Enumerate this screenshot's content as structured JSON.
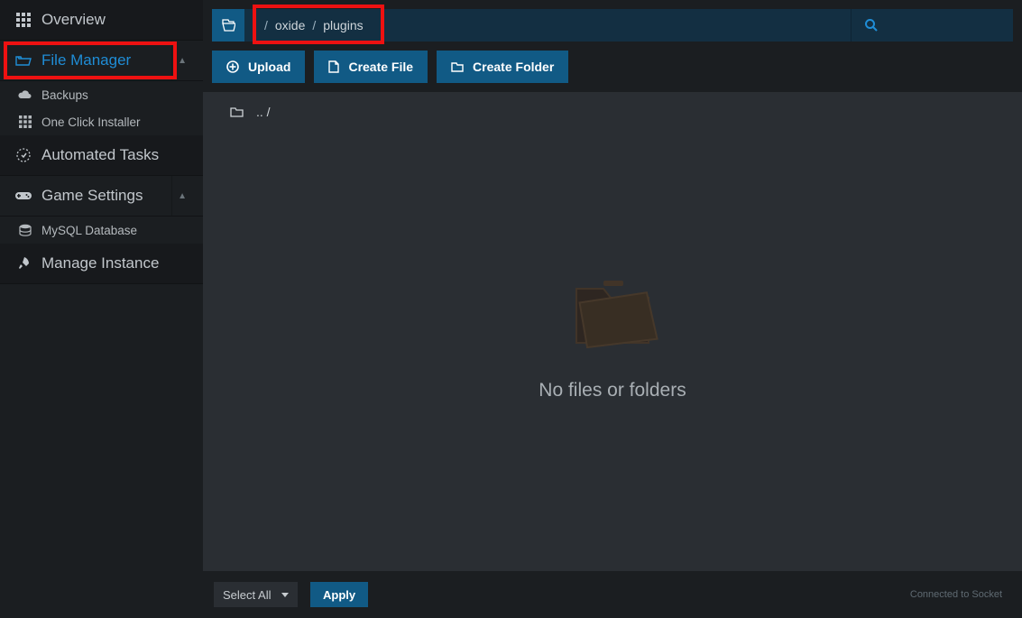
{
  "sidebar": {
    "overview": "Overview",
    "file_manager": "File Manager",
    "backups": "Backups",
    "one_click": "One Click Installer",
    "automated": "Automated Tasks",
    "game_settings": "Game Settings",
    "mysql": "MySQL Database",
    "manage_instance": "Manage Instance"
  },
  "breadcrumb": {
    "seg1": "oxide",
    "seg2": "plugins",
    "slash": "/"
  },
  "actions": {
    "upload": "Upload",
    "create_file": "Create File",
    "create_folder": "Create Folder"
  },
  "uprow": ".. /",
  "empty_message": "No files or folders",
  "footer": {
    "select_all": "Select All",
    "apply": "Apply",
    "socket": "Connected to Socket"
  }
}
